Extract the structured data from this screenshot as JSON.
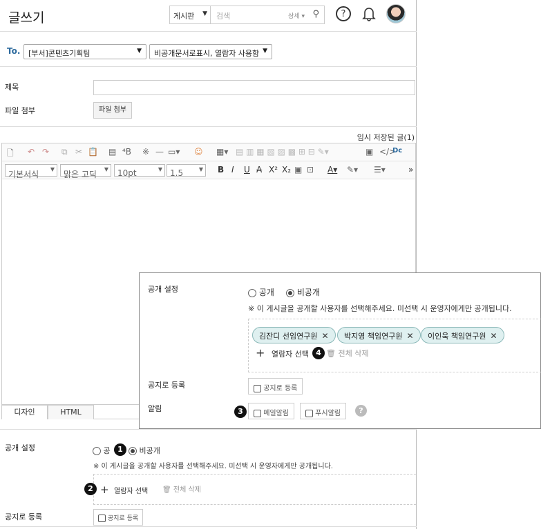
{
  "header": {
    "title": "글쓰기",
    "board_select": "게시판",
    "search_placeholder": "검색",
    "search_detail": "상세",
    "help_icon": "?"
  },
  "to": {
    "label": "To.",
    "department": "[부서]콘텐츠기획팀",
    "option": "비공개문서로표시, 열람자 사용함"
  },
  "form": {
    "subject_label": "제목",
    "attach_label": "파일 첨부",
    "attach_button": "파일 첨부",
    "temp_saved": "임시 저장된 글(1)"
  },
  "editor_toolbar": {
    "style": "기본서식",
    "font": "맑은 고딕",
    "size": "10pt",
    "line_height": "1.5",
    "bold": "B",
    "italic": "I",
    "underline": "U",
    "strike": "A",
    "sup": "X²",
    "sub": "X₂",
    "more": "»"
  },
  "tabs": [
    "디자인",
    "HTML"
  ],
  "bottom": {
    "visibility_label": "공개 설정",
    "public_partial": "공",
    "private_label": "비공개",
    "notice_text": "※ 이 게시글을 공개할 사용자를 선택해주세요. 미선택 시 운영자에게만 공개됩니다.",
    "add_viewer": "열람자 선택",
    "delete_all": "전체 삭제",
    "notice_reg_label": "공지로 등록",
    "notice_reg_button": "공지로 등록"
  },
  "popup": {
    "visibility_label": "공개 설정",
    "public_label": "공개",
    "private_label": "비공개",
    "notice_text": "※ 이 게시글을 공개할 사용자를 선택해주세요. 미선택 시 운영자에게만 공개됩니다.",
    "viewers": [
      "김잔디 선임연구원",
      "박지영 책임연구원",
      "이인욱 책임연구원"
    ],
    "add_viewer": "열람자 선택",
    "delete_all": "전체 삭제",
    "notice_reg_label": "공지로 등록",
    "notice_reg_button": "공지로 등록",
    "alarm_label": "알림",
    "mail_alarm": "메일알림",
    "push_alarm": "푸시알림"
  },
  "badges": [
    "1",
    "2",
    "3",
    "4"
  ],
  "colors": {
    "accent": "#2e6b9e",
    "chip_bg": "#dff0f0",
    "chip_border": "#8ab8b8",
    "badge": "#111111"
  }
}
